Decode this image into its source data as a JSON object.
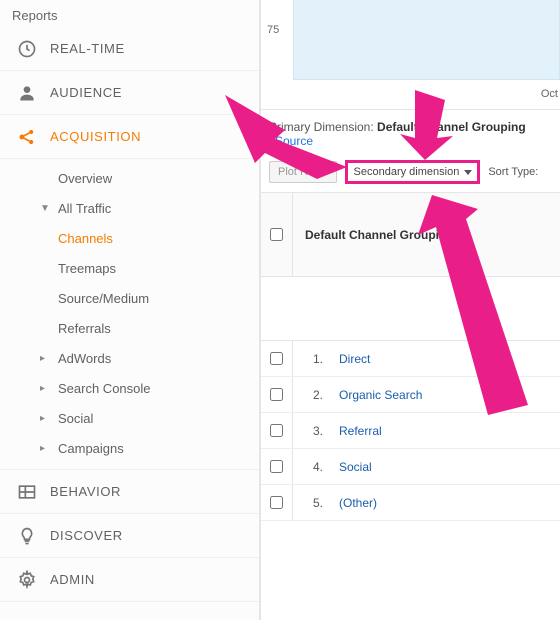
{
  "sidebar": {
    "title": "Reports",
    "items": [
      {
        "label": "REAL-TIME",
        "icon": "clock"
      },
      {
        "label": "AUDIENCE",
        "icon": "person"
      },
      {
        "label": "ACQUISITION",
        "icon": "share",
        "active": true
      },
      {
        "label": "BEHAVIOR",
        "icon": "grid"
      },
      {
        "label": "DISCOVER",
        "icon": "bulb"
      },
      {
        "label": "ADMIN",
        "icon": "gear"
      }
    ],
    "acquisition_children": [
      {
        "label": "Overview",
        "caret": ""
      },
      {
        "label": "All Traffic",
        "caret": "▼"
      },
      {
        "label": "Channels",
        "indent": true,
        "selected": true
      },
      {
        "label": "Treemaps",
        "indent": true
      },
      {
        "label": "Source/Medium",
        "indent": true
      },
      {
        "label": "Referrals",
        "indent": true
      },
      {
        "label": "AdWords",
        "caret": "▸"
      },
      {
        "label": "Search Console",
        "caret": "▸"
      },
      {
        "label": "Social",
        "caret": "▸"
      },
      {
        "label": "Campaigns",
        "caret": "▸"
      }
    ]
  },
  "main": {
    "chart": {
      "tick": "75",
      "date_label": "Oct"
    },
    "primary_dimension_label": "Primary Dimension:",
    "primary_dimension_value": "Default Channel Grouping",
    "source_link": "Source",
    "plot_rows": "Plot Rows",
    "secondary_dimension": "Secondary dimension",
    "sort_type_label": "Sort Type:",
    "column_header": "Default Channel Grouping",
    "rows": [
      {
        "rank": "1.",
        "label": "Direct"
      },
      {
        "rank": "2.",
        "label": "Organic Search"
      },
      {
        "rank": "3.",
        "label": "Referral"
      },
      {
        "rank": "4.",
        "label": "Social"
      },
      {
        "rank": "5.",
        "label": "(Other)"
      }
    ]
  }
}
